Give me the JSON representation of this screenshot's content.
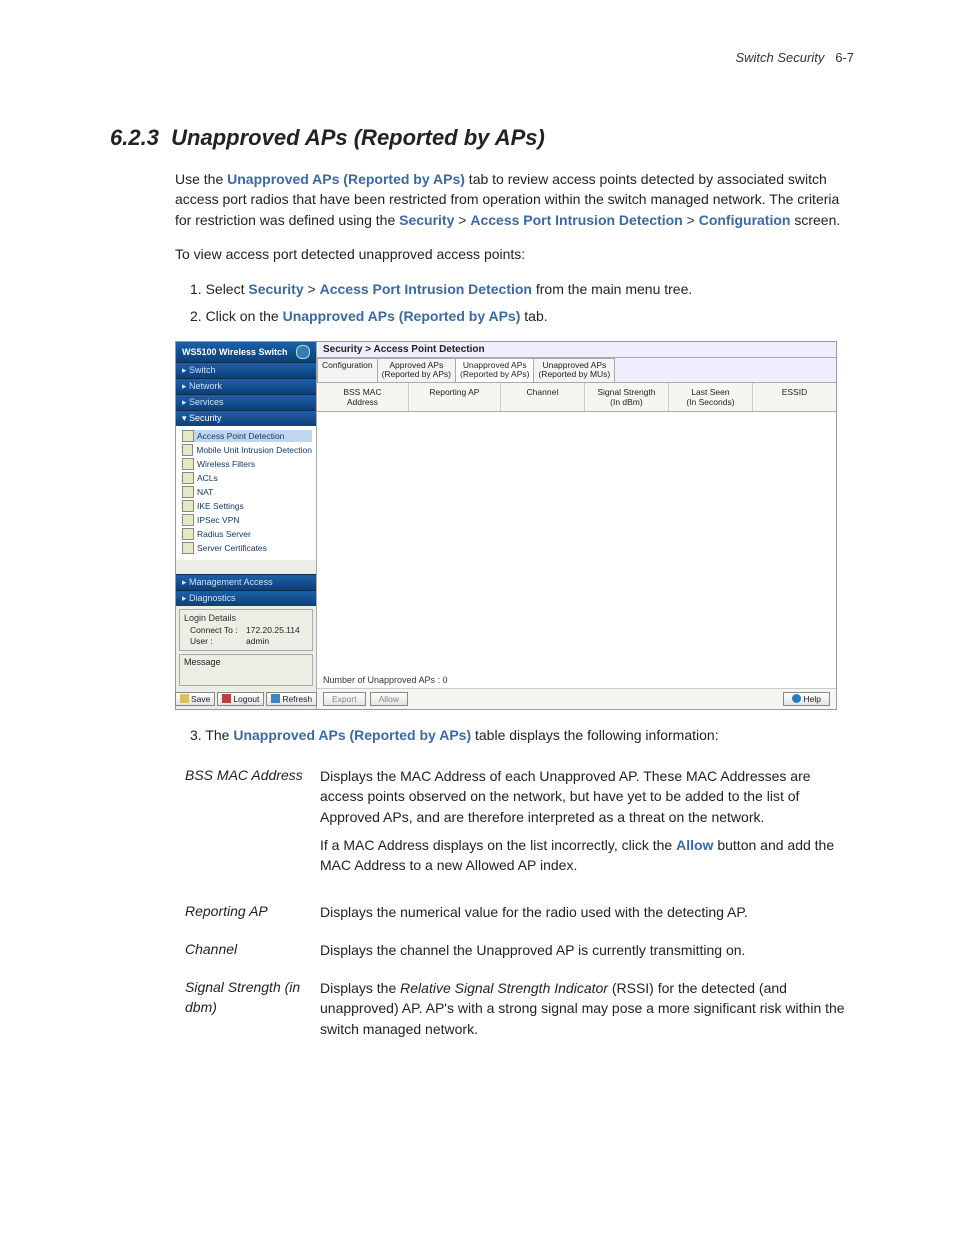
{
  "header": {
    "chapter": "Switch Security",
    "page": "6-7"
  },
  "section": {
    "number": "6.2.3",
    "title": "Unapproved APs (Reported by APs)"
  },
  "intro": {
    "p1a": "Use the ",
    "p1_link": "Unapproved APs (Reported by APs)",
    "p1b": " tab to review access points detected by associated switch access port radios that have been restricted from operation within the switch managed network. The criteria for restriction was defined using the ",
    "p1_path1": "Security",
    "p1_sep": " > ",
    "p1_path2": "Access Port Intrusion Detection",
    "p1_path3": "Configuration",
    "p1c": " screen.",
    "p2": "To view access port detected unapproved access points:"
  },
  "steps": {
    "s1a": "1. Select ",
    "s1_link1": "Security",
    "s1_sep": " > ",
    "s1_link2": "Access Port Intrusion Detection",
    "s1b": " from the main menu tree.",
    "s2a": "2. Click on the ",
    "s2_link": "Unapproved APs (Reported by APs)",
    "s2b": " tab.",
    "s3a": "3. The ",
    "s3_link": "Unapproved APs (Reported by APs)",
    "s3b": " table displays the following information:"
  },
  "ui": {
    "product_title": "WS5100 Wireless Switch",
    "nav": {
      "switch": "▸  Switch",
      "network": "▸  Network",
      "services": "▸  Services",
      "security": "▾  Security",
      "mgmt": "▸  Management Access",
      "diag": "▸  Diagnostics"
    },
    "tree": {
      "apd": "Access Point Detection",
      "muid": "Mobile Unit Intrusion Detection",
      "wf": "Wireless Filters",
      "acls": "ACLs",
      "nat": "NAT",
      "ike": "IKE Settings",
      "ipsec": "IPSec VPN",
      "radius": "Radius Server",
      "certs": "Server Certificates"
    },
    "login": {
      "title": "Login Details",
      "connect_lbl": "Connect To :",
      "connect_val": "172.20.25.114",
      "user_lbl": "User :",
      "user_val": "admin"
    },
    "msg_title": "Message",
    "btn_save": "Save",
    "btn_logout": "Logout",
    "btn_refresh": "Refresh",
    "breadcrumb": "Security > Access Point Detection",
    "tabs": {
      "t1": "Configuration",
      "t2a": "Approved APs",
      "t2b": "(Reported by APs)",
      "t3a": "Unapproved APs",
      "t3b": "(Reported by APs)",
      "t4a": "Unapproved APs",
      "t4b": "(Reported by MUs)"
    },
    "cols": {
      "c1a": "BSS MAC",
      "c1b": "Address",
      "c2": "Reporting AP",
      "c3": "Channel",
      "c4a": "Signal Strength",
      "c4b": "(In dBm)",
      "c5a": "Last Seen",
      "c5b": "(In Seconds)",
      "c6": "ESSID"
    },
    "count": "Number of Unapproved APs :  0",
    "btn_export": "Export",
    "btn_allow": "Allow",
    "btn_help": "Help"
  },
  "desc": {
    "r1_term": "BSS MAC Address",
    "r1_p1": "Displays the MAC Address of each Unapproved AP. These MAC Addresses are access points observed on the network, but have yet to be added to the list of Approved APs, and are therefore interpreted as a threat on the network.",
    "r1_p2a": "If a MAC Address displays on the list incorrectly, click the ",
    "r1_p2_link": "Allow",
    "r1_p2b": " button and add the MAC Address to a new Allowed AP index.",
    "r2_term": "Reporting AP",
    "r2_def": "Displays the numerical value for the radio used with the detecting AP.",
    "r3_term": "Channel",
    "r3_def": "Displays the channel the Unapproved AP is currently transmitting on.",
    "r4_term": "Signal Strength (in dbm)",
    "r4_def_a": "Displays the ",
    "r4_def_em": "Relative Signal Strength Indicator",
    "r4_def_b": " (RSSI) for the detected (and unapproved) AP. AP's with a strong signal may pose a more significant risk within the switch managed network."
  }
}
